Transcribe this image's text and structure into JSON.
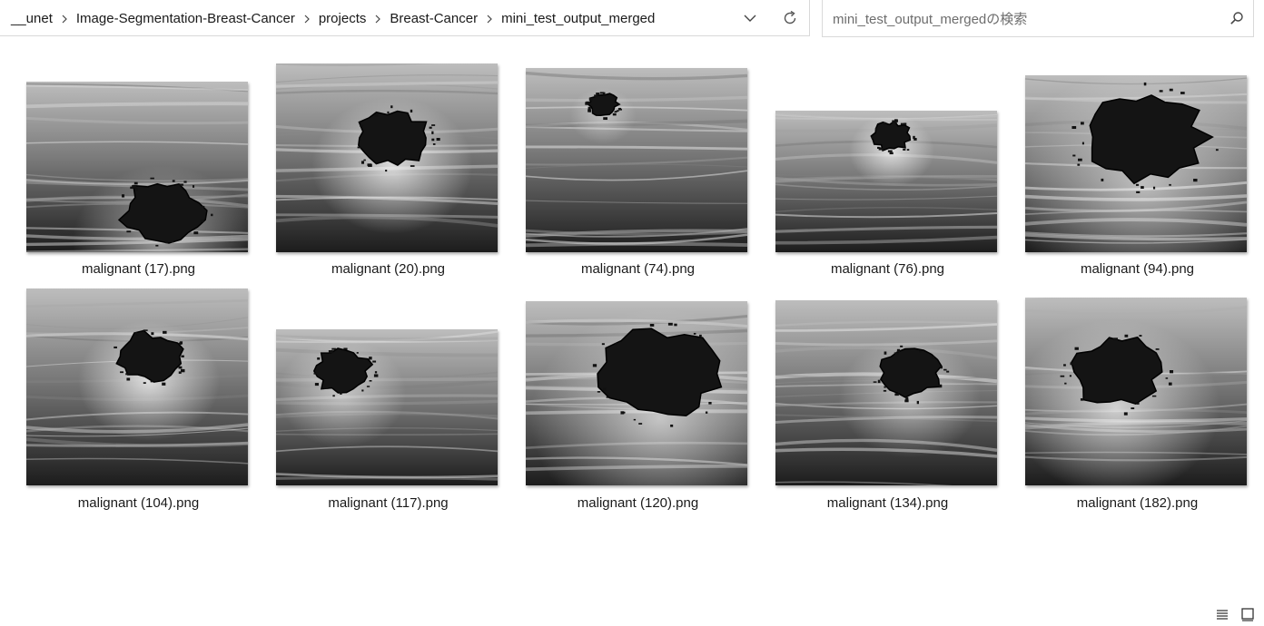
{
  "breadcrumbs": [
    "__unet",
    "Image-Segmentation-Breast-Cancer",
    "projects",
    "Breast-Cancer",
    "mini_test_output_merged"
  ],
  "search": {
    "placeholder": "mini_test_output_mergedの検索",
    "value": ""
  },
  "icons": {
    "separator": "chevron-right-icon",
    "history": "chevron-down-icon",
    "refresh": "refresh-icon",
    "search": "search-icon",
    "details_view": "details-view-icon",
    "large_icons_view": "large-icons-view-icon"
  },
  "files": [
    {
      "name": "malignant (17).png"
    },
    {
      "name": "malignant (20).png"
    },
    {
      "name": "malignant (74).png"
    },
    {
      "name": "malignant (76).png"
    },
    {
      "name": "malignant (94).png"
    },
    {
      "name": "malignant (104).png"
    },
    {
      "name": "malignant (117).png"
    },
    {
      "name": "malignant (120).png"
    },
    {
      "name": "malignant (134).png"
    },
    {
      "name": "malignant (182).png"
    }
  ],
  "colors": {
    "border": "#d9d9d9",
    "text": "#1a1a1a",
    "mask": "#111111"
  }
}
